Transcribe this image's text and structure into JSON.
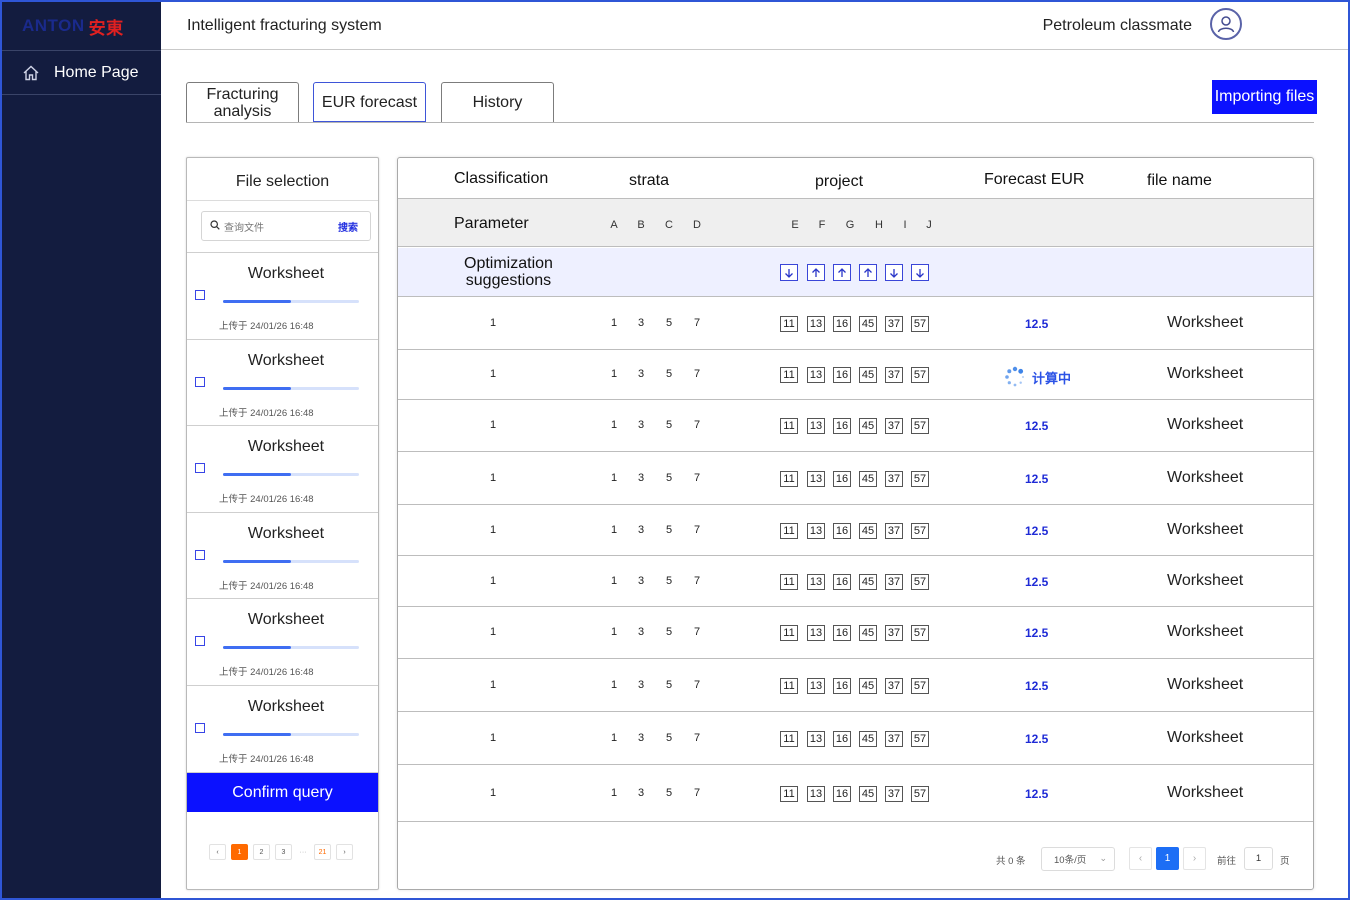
{
  "brand": {
    "logo_en": "ANTON",
    "logo_cn": "安東"
  },
  "sidebar": {
    "items": [
      {
        "label": "Home Page",
        "icon": "home-icon"
      }
    ]
  },
  "header": {
    "title": "Intelligent fracturing system",
    "user": "Petroleum classmate",
    "avatar_icon": "user-icon"
  },
  "tabs": [
    {
      "label": "Fracturing analysis",
      "active": false
    },
    {
      "label": "EUR forecast",
      "active": true
    },
    {
      "label": "History",
      "active": false
    }
  ],
  "toolbar": {
    "import_label": "Importing files"
  },
  "file_panel": {
    "title": "File selection",
    "search_placeholder": "查询文件",
    "search_button": "搜索",
    "files": [
      {
        "name": "Worksheet",
        "time": "上传于 24/01/26 16:48",
        "progress": 0.5
      },
      {
        "name": "Worksheet",
        "time": "上传于 24/01/26 16:48",
        "progress": 0.5
      },
      {
        "name": "Worksheet",
        "time": "上传于 24/01/26 16:48",
        "progress": 0.5
      },
      {
        "name": "Worksheet",
        "time": "上传于 24/01/26 16:48",
        "progress": 0.5
      },
      {
        "name": "Worksheet",
        "time": "上传于 24/01/26 16:48",
        "progress": 0.5
      },
      {
        "name": "Worksheet",
        "time": "上传于 24/01/26 16:48",
        "progress": 0.5
      }
    ],
    "confirm_label": "Confirm query",
    "pager": {
      "pages": [
        "1",
        "2",
        "3",
        "···",
        "21"
      ],
      "current": "1"
    }
  },
  "table": {
    "headers": {
      "classification": "Classification",
      "strata": "strata",
      "project": "project",
      "forecast": "Forecast EUR",
      "file_name": "file name"
    },
    "parameter_label": "Parameter",
    "strata_letters": [
      "A",
      "B",
      "C",
      "D"
    ],
    "project_letters": [
      "E",
      "F",
      "G",
      "H",
      "I",
      "J"
    ],
    "optimization_label": "Optimization\nsuggestions",
    "optimization_arrows": [
      "down",
      "up",
      "up",
      "up",
      "down",
      "down"
    ],
    "rows": [
      {
        "classification": "1",
        "strata": [
          "1",
          "3",
          "5",
          "7"
        ],
        "project": [
          "11",
          "13",
          "16",
          "45",
          "37",
          "57"
        ],
        "eur": "12.5",
        "file": "Worksheet"
      },
      {
        "classification": "1",
        "strata": [
          "1",
          "3",
          "5",
          "7"
        ],
        "project": [
          "11",
          "13",
          "16",
          "45",
          "37",
          "57"
        ],
        "eur": "计算中",
        "calculating": true,
        "file": "Worksheet"
      },
      {
        "classification": "1",
        "strata": [
          "1",
          "3",
          "5",
          "7"
        ],
        "project": [
          "11",
          "13",
          "16",
          "45",
          "37",
          "57"
        ],
        "eur": "12.5",
        "file": "Worksheet"
      },
      {
        "classification": "1",
        "strata": [
          "1",
          "3",
          "5",
          "7"
        ],
        "project": [
          "11",
          "13",
          "16",
          "45",
          "37",
          "57"
        ],
        "eur": "12.5",
        "file": "Worksheet"
      },
      {
        "classification": "1",
        "strata": [
          "1",
          "3",
          "5",
          "7"
        ],
        "project": [
          "11",
          "13",
          "16",
          "45",
          "37",
          "57"
        ],
        "eur": "12.5",
        "file": "Worksheet"
      },
      {
        "classification": "1",
        "strata": [
          "1",
          "3",
          "5",
          "7"
        ],
        "project": [
          "11",
          "13",
          "16",
          "45",
          "37",
          "57"
        ],
        "eur": "12.5",
        "file": "Worksheet"
      },
      {
        "classification": "1",
        "strata": [
          "1",
          "3",
          "5",
          "7"
        ],
        "project": [
          "11",
          "13",
          "16",
          "45",
          "37",
          "57"
        ],
        "eur": "12.5",
        "file": "Worksheet"
      },
      {
        "classification": "1",
        "strata": [
          "1",
          "3",
          "5",
          "7"
        ],
        "project": [
          "11",
          "13",
          "16",
          "45",
          "37",
          "57"
        ],
        "eur": "12.5",
        "file": "Worksheet"
      },
      {
        "classification": "1",
        "strata": [
          "1",
          "3",
          "5",
          "7"
        ],
        "project": [
          "11",
          "13",
          "16",
          "45",
          "37",
          "57"
        ],
        "eur": "12.5",
        "file": "Worksheet"
      },
      {
        "classification": "1",
        "strata": [
          "1",
          "3",
          "5",
          "7"
        ],
        "project": [
          "11",
          "13",
          "16",
          "45",
          "37",
          "57"
        ],
        "eur": "12.5",
        "file": "Worksheet"
      }
    ],
    "pager": {
      "total": "共 0 条",
      "page_size": "10条/页",
      "current": "1",
      "goto_label": "前往",
      "goto_value": "1",
      "unit": "页"
    }
  },
  "colors": {
    "sidebar_bg": "#131c3f",
    "accent": "#0b11ff",
    "eur_text": "#1f2bd6",
    "page_active": "#1d6ef5",
    "mini_page_active": "#ff6a00"
  }
}
